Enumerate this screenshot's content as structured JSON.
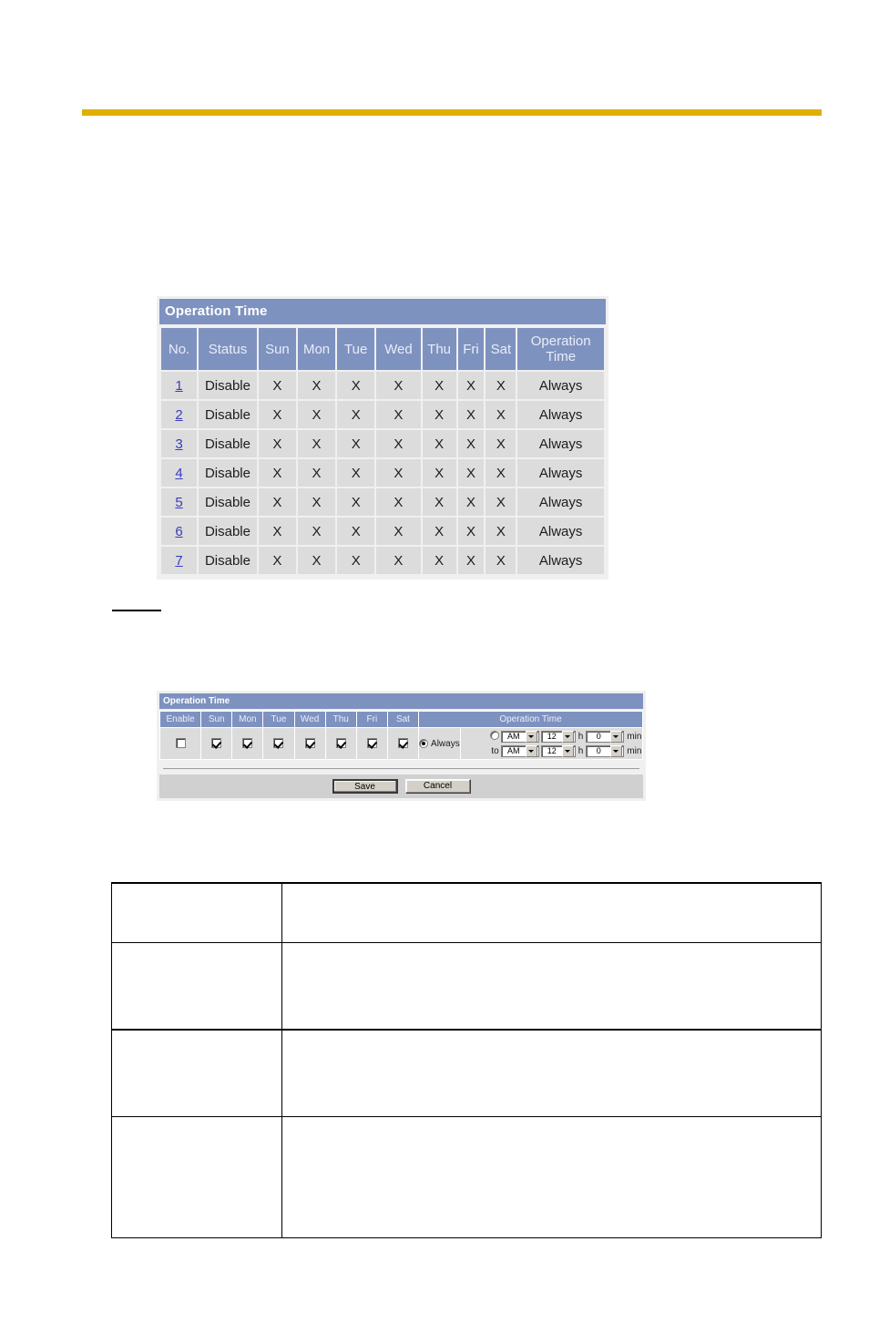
{
  "page": {
    "accent_color": "#e0b000",
    "header_blue": "#7e92c0",
    "cell_gray": "#dcdcdc",
    "link_color": "#3b3bbd"
  },
  "list_panel": {
    "title": "Operation Time",
    "columns": [
      "No.",
      "Status",
      "Sun",
      "Mon",
      "Tue",
      "Wed",
      "Thu",
      "Fri",
      "Sat",
      "Operation Time"
    ],
    "operation_time_header_line1": "Operation",
    "operation_time_header_line2": "Time",
    "rows": [
      {
        "no": "1",
        "status": "Disable",
        "sun": "X",
        "mon": "X",
        "tue": "X",
        "wed": "X",
        "thu": "X",
        "fri": "X",
        "sat": "X",
        "operation_time": "Always"
      },
      {
        "no": "2",
        "status": "Disable",
        "sun": "X",
        "mon": "X",
        "tue": "X",
        "wed": "X",
        "thu": "X",
        "fri": "X",
        "sat": "X",
        "operation_time": "Always"
      },
      {
        "no": "3",
        "status": "Disable",
        "sun": "X",
        "mon": "X",
        "tue": "X",
        "wed": "X",
        "thu": "X",
        "fri": "X",
        "sat": "X",
        "operation_time": "Always"
      },
      {
        "no": "4",
        "status": "Disable",
        "sun": "X",
        "mon": "X",
        "tue": "X",
        "wed": "X",
        "thu": "X",
        "fri": "X",
        "sat": "X",
        "operation_time": "Always"
      },
      {
        "no": "5",
        "status": "Disable",
        "sun": "X",
        "mon": "X",
        "tue": "X",
        "wed": "X",
        "thu": "X",
        "fri": "X",
        "sat": "X",
        "operation_time": "Always"
      },
      {
        "no": "6",
        "status": "Disable",
        "sun": "X",
        "mon": "X",
        "tue": "X",
        "wed": "X",
        "thu": "X",
        "fri": "X",
        "sat": "X",
        "operation_time": "Always"
      },
      {
        "no": "7",
        "status": "Disable",
        "sun": "X",
        "mon": "X",
        "tue": "X",
        "wed": "X",
        "thu": "X",
        "fri": "X",
        "sat": "X",
        "operation_time": "Always"
      }
    ]
  },
  "edit_panel": {
    "title": "Operation Time",
    "columns": [
      "Enable",
      "Sun",
      "Mon",
      "Tue",
      "Wed",
      "Thu",
      "Fri",
      "Sat",
      "Operation Time"
    ],
    "enable_checked": false,
    "days": [
      {
        "label": "Sun",
        "checked": true
      },
      {
        "label": "Mon",
        "checked": true
      },
      {
        "label": "Tue",
        "checked": true
      },
      {
        "label": "Wed",
        "checked": true
      },
      {
        "label": "Thu",
        "checked": true
      },
      {
        "label": "Fri",
        "checked": true
      },
      {
        "label": "Sat",
        "checked": true
      }
    ],
    "always_label": "Always",
    "always_selected": true,
    "range_selected": false,
    "to_label": "to",
    "start": {
      "ampm": "AM",
      "hour": "12",
      "hour_unit": "h",
      "minute": "0",
      "minute_unit": "min"
    },
    "end": {
      "ampm": "AM",
      "hour": "12",
      "hour_unit": "h",
      "minute": "0",
      "minute_unit": "min"
    },
    "buttons": {
      "save": "Save",
      "cancel": "Cancel"
    }
  },
  "description_table": {
    "rows": [
      {
        "term": "",
        "detail": ""
      },
      {
        "term": "",
        "detail": ""
      },
      {
        "term": "",
        "detail": ""
      },
      {
        "term": "",
        "detail": ""
      }
    ]
  }
}
